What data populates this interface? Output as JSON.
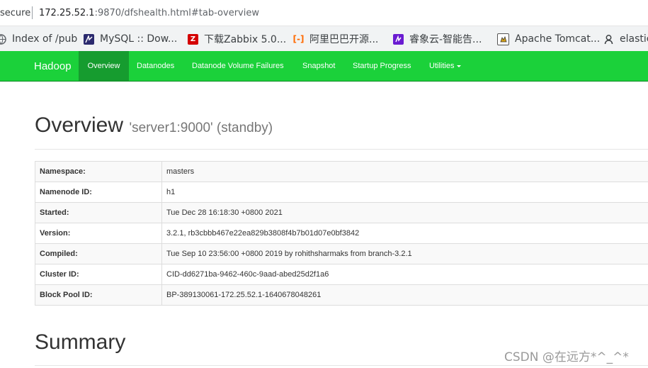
{
  "browser": {
    "security_label": "secure",
    "url_host": "172.25.52.1",
    "url_path": ":9870/dfshealth.html#tab-overview",
    "bookmarks": [
      {
        "label": "Index of /pub",
        "icon": "globe-icon",
        "color": "#5f6368"
      },
      {
        "label": "MySQL :: Dow...",
        "icon": "mysql-icon",
        "color": "#2b2a6e"
      },
      {
        "label": "下载Zabbix 5.0...",
        "icon": "zabbix-icon",
        "color": "#d40000"
      },
      {
        "label": "阿里巴巴开源...",
        "icon": "alibaba-icon",
        "color": "#ff6a00"
      },
      {
        "label": "睿象云-智能告...",
        "icon": "ruixiangyun-icon",
        "color": "#6a1bd1"
      },
      {
        "label": "Apache Tomcat...",
        "icon": "tomcat-icon",
        "color": "#333333"
      },
      {
        "label": "elastic",
        "icon": "elastic-icon",
        "color": "#3c4043"
      }
    ]
  },
  "navbar": {
    "brand": "Hadoop",
    "items": [
      {
        "label": "Overview",
        "active": true
      },
      {
        "label": "Datanodes"
      },
      {
        "label": "Datanode Volume Failures"
      },
      {
        "label": "Snapshot"
      },
      {
        "label": "Startup Progress"
      },
      {
        "label": "Utilities"
      }
    ],
    "bg_color": "#1bd13a",
    "active_color": "#169c2f"
  },
  "overview": {
    "title": "Overview",
    "subtitle": "'server1:9000' (standby)",
    "rows": [
      {
        "key": "Namespace:",
        "value": "masters"
      },
      {
        "key": "Namenode ID:",
        "value": "h1"
      },
      {
        "key": "Started:",
        "value": "Tue Dec 28 16:18:30 +0800 2021"
      },
      {
        "key": "Version:",
        "value": "3.2.1, rb3cbbb467e22ea829b3808f4b7b01d07e0bf3842"
      },
      {
        "key": "Compiled:",
        "value": "Tue Sep 10 23:56:00 +0800 2019 by rohithsharmaks from branch-3.2.1"
      },
      {
        "key": "Cluster ID:",
        "value": "CID-dd6271ba-9462-460c-9aad-abed25d2f1a6"
      },
      {
        "key": "Block Pool ID:",
        "value": "BP-389130061-172.25.52.1-1640678048261"
      }
    ]
  },
  "summary": {
    "title": "Summary"
  },
  "watermark": "CSDN @在远方*^_^*"
}
